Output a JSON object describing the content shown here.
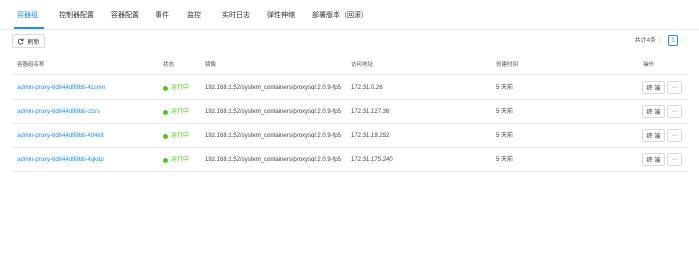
{
  "tabs": [
    {
      "label": "容器组",
      "active": true
    },
    {
      "label": "控制器配置",
      "active": false
    },
    {
      "label": "容器配置",
      "active": false
    },
    {
      "label": "事件",
      "active": false
    },
    {
      "label": "监控",
      "active": false
    },
    {
      "label": "实时日志",
      "active": false
    },
    {
      "label": "弹性伸缩",
      "active": false
    },
    {
      "label": "部署版本（回滚）",
      "active": false
    }
  ],
  "toolbar": {
    "refresh_label": "刷新",
    "refresh_icon": "refresh-icon"
  },
  "pagination": {
    "total_text": "共计4条",
    "current_page": "1",
    "prev_glyph": "‹",
    "next_glyph": "›"
  },
  "table": {
    "columns": [
      "容器组名称",
      "状态",
      "镜像",
      "访问地址",
      "创建时间",
      "操作"
    ],
    "rows": [
      {
        "name": "admin-proxy-6d644d99bb-4zsmn",
        "status": "运行中",
        "image": "192.168.1.52/system_containers/proxysql:2.0.9-fp5",
        "address": "172.31.0.26",
        "created": "5 天前",
        "action": "终 端",
        "more": "···"
      },
      {
        "name": "admin-proxy-6d644d99bb-ctzrs",
        "status": "运行中",
        "image": "192.168.1.52/system_containers/proxysql:2.0.9-fp5",
        "address": "172.31.127.36",
        "created": "5 天前",
        "action": "终 端",
        "more": "···"
      },
      {
        "name": "admin-proxy-6d644d99bb-484k8",
        "status": "运行中",
        "image": "192.168.1.52/system_containers/proxysql:2.0.9-fp5",
        "address": "172.31.19.252",
        "created": "5 天前",
        "action": "终 端",
        "more": "···"
      },
      {
        "name": "admin-proxy-6d644d99bb-4qkdp",
        "status": "运行中",
        "image": "192.168.1.52/system_containers/proxysql:2.0.9-fp5",
        "address": "172.31.175.240",
        "created": "5 天前",
        "action": "终 端",
        "more": "···"
      }
    ]
  },
  "colors": {
    "accent": "#1890ff",
    "running": "#52c41a",
    "border": "#ececec"
  }
}
